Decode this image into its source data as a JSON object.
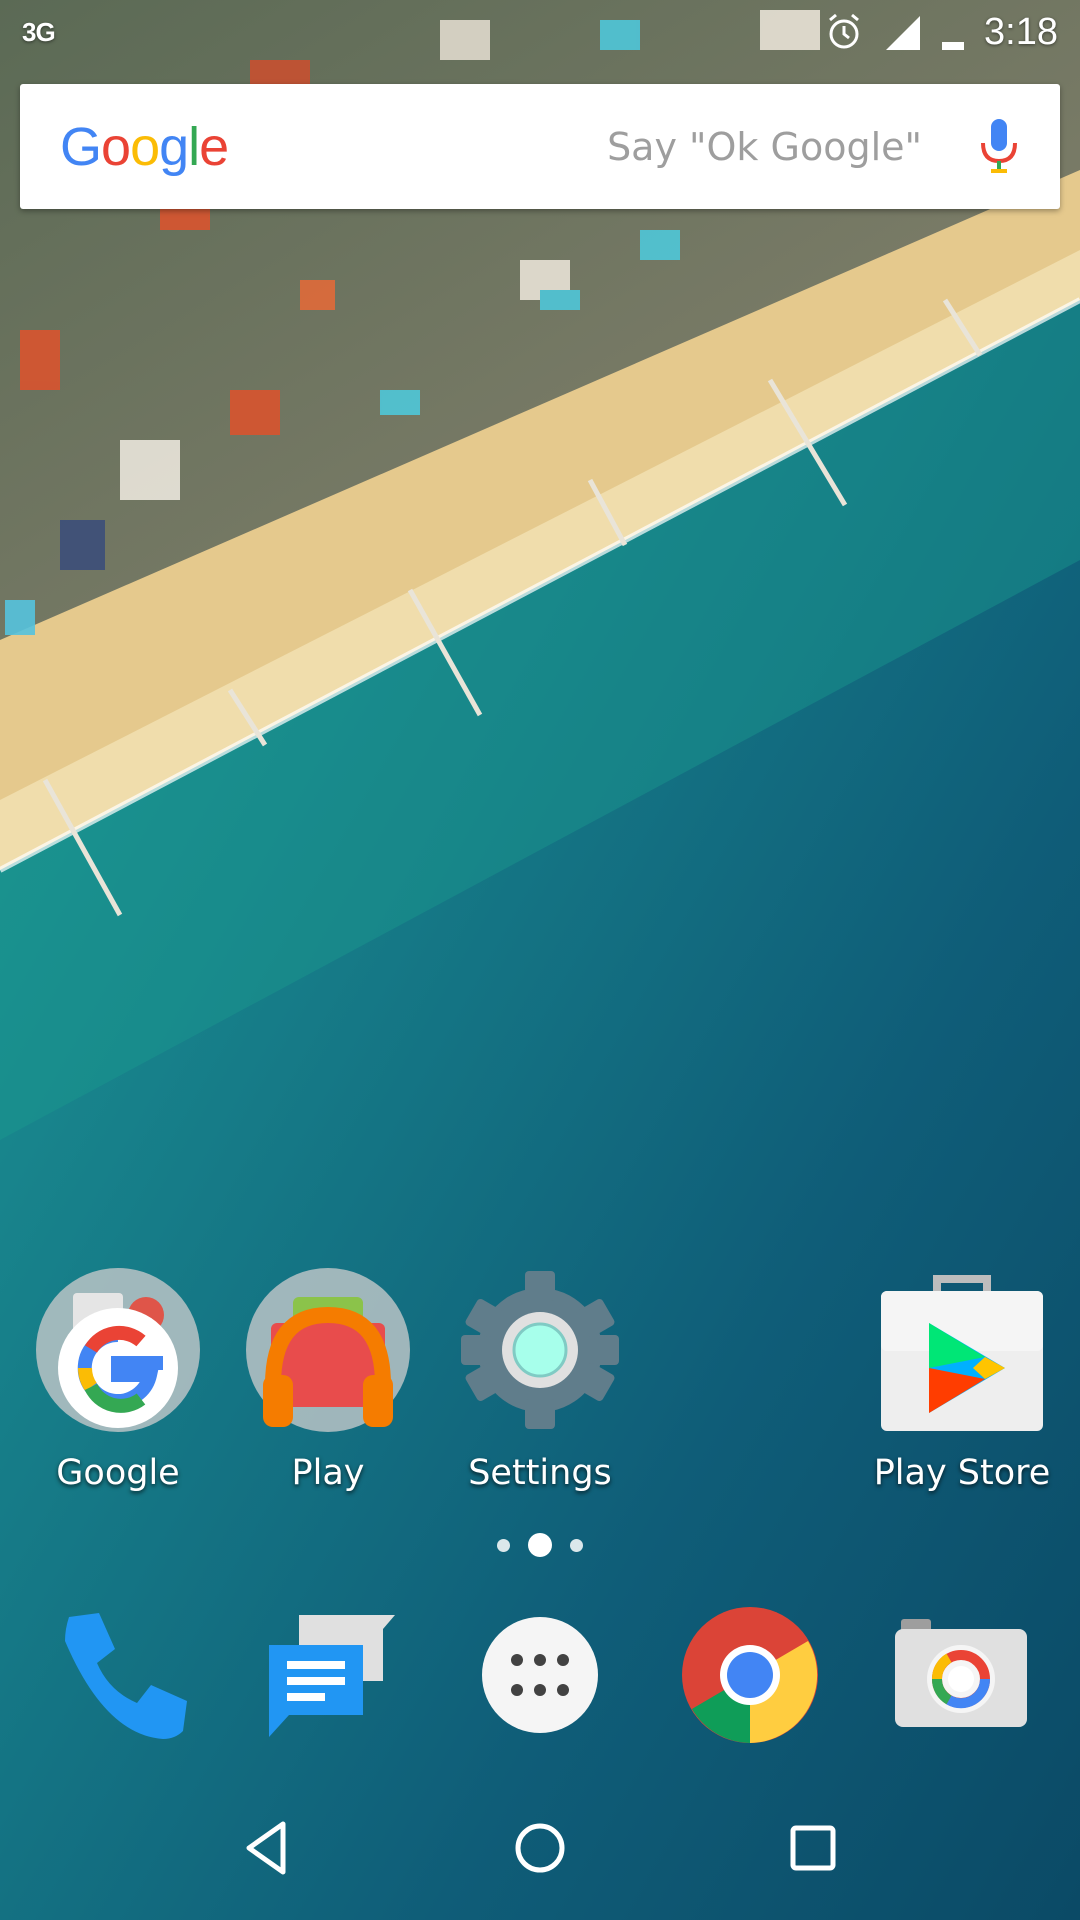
{
  "status_bar": {
    "network_type": "3G",
    "time": "3:18",
    "icons": [
      "alarm-icon",
      "signal-icon",
      "battery-icon"
    ]
  },
  "search": {
    "logo_text": "Google",
    "hint": "Say \"Ok Google\"",
    "icon": "mic-icon"
  },
  "home_apps": [
    {
      "label": "Google",
      "icon": "google-folder-icon"
    },
    {
      "label": "Play",
      "icon": "play-folder-icon"
    },
    {
      "label": "Settings",
      "icon": "settings-icon"
    },
    {
      "label": "Play Store",
      "icon": "play-store-icon"
    }
  ],
  "page_indicator": {
    "pages": 3,
    "active_page": 2
  },
  "dock": [
    {
      "icon": "phone-icon"
    },
    {
      "icon": "messenger-icon"
    },
    {
      "icon": "app-drawer-icon"
    },
    {
      "icon": "chrome-icon"
    },
    {
      "icon": "camera-icon"
    }
  ],
  "nav_bar": [
    "back-icon",
    "home-icon",
    "recents-icon"
  ],
  "colors": {
    "google_blue": "#4285F4",
    "google_red": "#EA4335",
    "google_yellow": "#FBBC05",
    "google_green": "#34A853",
    "sea_deep": "#0d4f68",
    "sand": "#e8cf96"
  }
}
